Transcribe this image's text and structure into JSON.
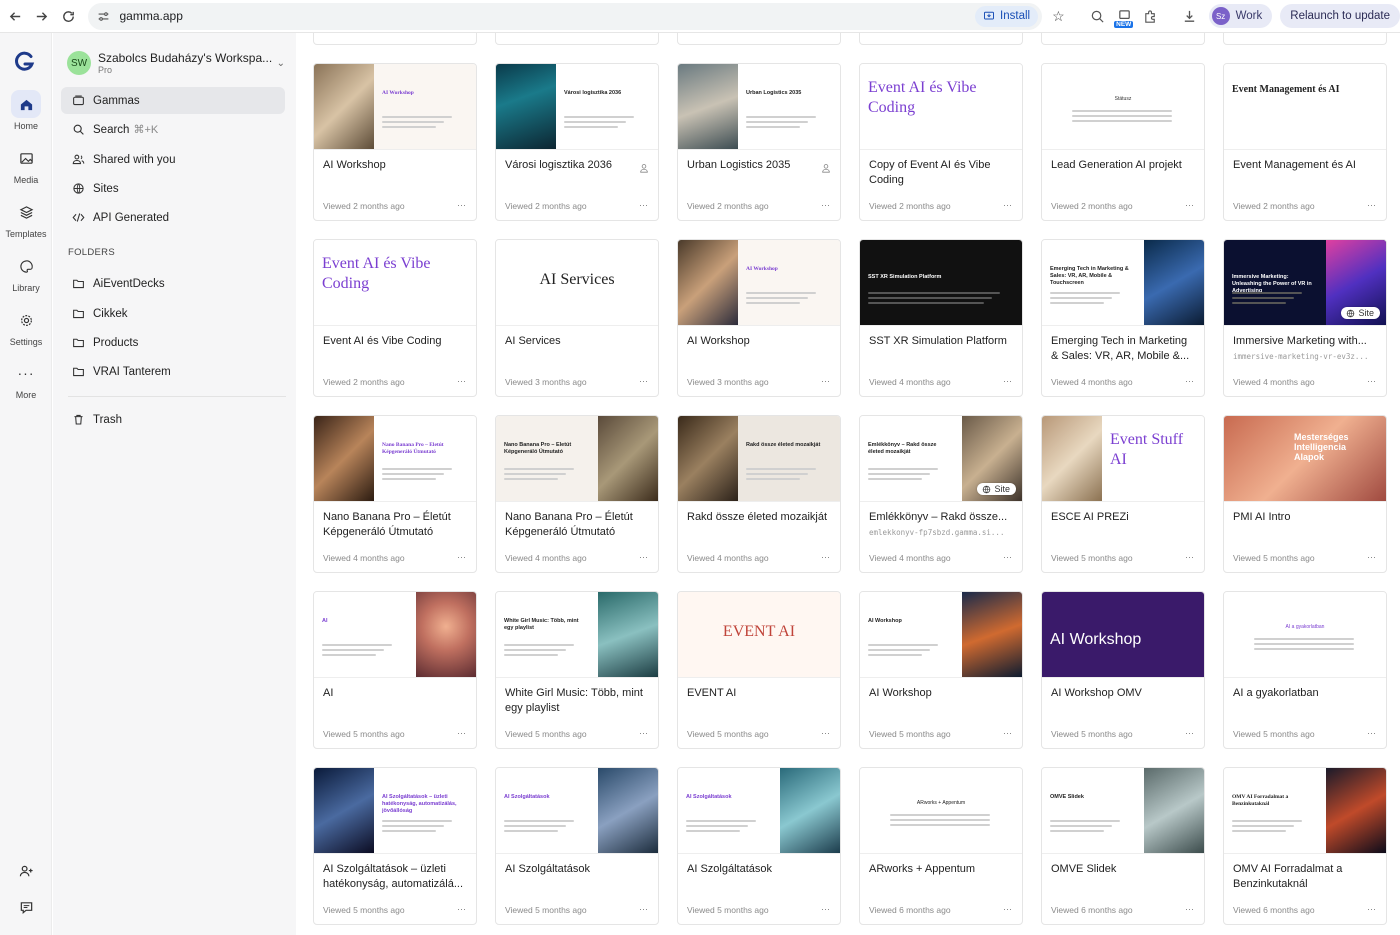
{
  "browser": {
    "url": "gamma.app",
    "install_label": "Install",
    "new_badge": "NEW",
    "profile_initials": "Sz",
    "profile_label": "Work",
    "relaunch_label": "Relaunch to update"
  },
  "rail": {
    "items": [
      {
        "label": "Home",
        "icon": "home-icon"
      },
      {
        "label": "Media",
        "icon": "image-icon"
      },
      {
        "label": "Templates",
        "icon": "layers-icon"
      },
      {
        "label": "Library",
        "icon": "palette-icon"
      },
      {
        "label": "Settings",
        "icon": "gear-icon"
      },
      {
        "label": "More",
        "icon": "more-icon"
      }
    ]
  },
  "sidebar": {
    "workspace_initials": "SW",
    "workspace_name": "Szabolcs Budaházy's Workspa...",
    "workspace_plan": "Pro",
    "nav": [
      {
        "label": "Gammas",
        "icon": "gammas-icon"
      },
      {
        "label": "Search",
        "shortcut": "⌘+K",
        "icon": "search-icon"
      },
      {
        "label": "Shared with you",
        "icon": "users-icon"
      },
      {
        "label": "Sites",
        "icon": "globe-icon"
      },
      {
        "label": "API Generated",
        "icon": "code-icon"
      }
    ],
    "folders_heading": "FOLDERS",
    "folders": [
      "AiEventDecks",
      "Cikkek",
      "Products",
      "VRAI Tanterem"
    ],
    "trash_label": "Trash"
  },
  "cards": [
    {
      "title": "AI Workshop",
      "meta": "Viewed 2 months ago",
      "thumb": "AI Workshop"
    },
    {
      "title": "Városi logisztika 2036",
      "meta": "Viewed 2 months ago",
      "thumb": "Városi logisztika 2036",
      "shared": true
    },
    {
      "title": "Urban Logistics 2035",
      "meta": "Viewed 2 months ago",
      "thumb": "Urban Logistics 2035",
      "shared": true
    },
    {
      "title": "Copy of Event AI és Vibe Coding",
      "meta": "Viewed 2 months ago",
      "thumb": "Event AI és Vibe Coding"
    },
    {
      "title": "Lead Generation AI projekt",
      "meta": "Viewed 2 months ago",
      "thumb": "Státusz"
    },
    {
      "title": "Event Management és AI",
      "meta": "Viewed 2 months ago",
      "thumb": "Event Management és AI"
    },
    {
      "title": "Event AI és Vibe Coding",
      "meta": "Viewed 2 months ago",
      "thumb": "Event AI és Vibe Coding"
    },
    {
      "title": "AI Services",
      "meta": "Viewed 3 months ago",
      "thumb": "AI Services"
    },
    {
      "title": "AI Workshop",
      "meta": "Viewed 3 months ago",
      "thumb": "AI Workshop"
    },
    {
      "title": "SST XR Simulation Platform",
      "meta": "Viewed 4 months ago",
      "thumb": "SST XR Simulation Platform"
    },
    {
      "title": "Emerging Tech in Marketing & Sales: VR, AR, Mobile &...",
      "meta": "Viewed 4 months ago",
      "thumb": "Emerging Tech in Marketing & Sales: VR, AR, Mobile & Touchscreen"
    },
    {
      "title": "Immersive Marketing with...",
      "url": "immersive-marketing-vr-ev3z...",
      "meta": "Viewed 4 months ago",
      "thumb": "Immersive Marketing: Unleashing the Power of VR in Advertising",
      "site": "Site"
    },
    {
      "title": "Nano Banana Pro – Életút Képgeneráló Útmutató",
      "meta": "Viewed 4 months ago",
      "thumb": "Nano Banana Pro – Életút Képgeneráló Útmutató"
    },
    {
      "title": "Nano Banana Pro – Életút Képgeneráló Útmutató",
      "meta": "Viewed 4 months ago",
      "thumb": "Nano Banana Pro – Életút Képgeneráló Útmutató"
    },
    {
      "title": "Rakd össze életed mozaikját",
      "meta": "Viewed 4 months ago",
      "thumb": "Rakd össze életed mozaikját"
    },
    {
      "title": "Emlékkönyv – Rakd össze...",
      "url": "emlekkonyv-fp7sbzd.gamma.si...",
      "meta": "Viewed 4 months ago",
      "thumb": "Emlékkönyv – Rakd össze életed mozaikját",
      "site": "Site"
    },
    {
      "title": "ESCE AI PREZi",
      "meta": "Viewed 5 months ago",
      "thumb": "Event Stuff AI"
    },
    {
      "title": "PMI AI Intro",
      "meta": "Viewed 5 months ago",
      "thumb": "Mesterséges Intelligencia Alapok"
    },
    {
      "title": "AI",
      "meta": "Viewed 5 months ago",
      "thumb": "AI"
    },
    {
      "title": "White Girl Music: Több, mint egy playlist",
      "meta": "Viewed 5 months ago",
      "thumb": "White Girl Music: Több, mint egy playlist"
    },
    {
      "title": "EVENT AI",
      "meta": "Viewed 5 months ago",
      "thumb": "EVENT AI"
    },
    {
      "title": "AI Workshop",
      "meta": "Viewed 5 months ago",
      "thumb": "AI Workshop"
    },
    {
      "title": "AI Workshop OMV",
      "meta": "Viewed 5 months ago",
      "thumb": "AI Workshop"
    },
    {
      "title": "AI a gyakorlatban",
      "meta": "Viewed 5 months ago",
      "thumb": "AI a gyakorlatban"
    },
    {
      "title": "AI Szolgáltatások – üzleti hatékonyság, automatizálá...",
      "meta": "Viewed 5 months ago",
      "thumb": "AI Szolgáltatások – üzleti hatékonyság, automatizálás, jövőállóság"
    },
    {
      "title": "AI Szolgáltatások",
      "meta": "Viewed 5 months ago",
      "thumb": "AI Szolgáltatások"
    },
    {
      "title": "AI Szolgáltatások",
      "meta": "Viewed 5 months ago",
      "thumb": "AI Szolgáltatások"
    },
    {
      "title": "ARworks + Appentum",
      "meta": "Viewed 6 months ago",
      "thumb": "ARworks + Appentum"
    },
    {
      "title": "OMVE Slidek",
      "meta": "Viewed 6 months ago",
      "thumb": "OMVE Slidek"
    },
    {
      "title": "OMV AI Forradalmat a Benzinkutaknál",
      "meta": "Viewed 6 months ago",
      "thumb": "OMV AI Forradalmat a Benzinkutaknál"
    }
  ],
  "more_glyph": "···",
  "colors": {
    "accent": "#1e3a8a",
    "purple": "#7b3fd1",
    "sidebar_bg": "#f6f6f7"
  }
}
